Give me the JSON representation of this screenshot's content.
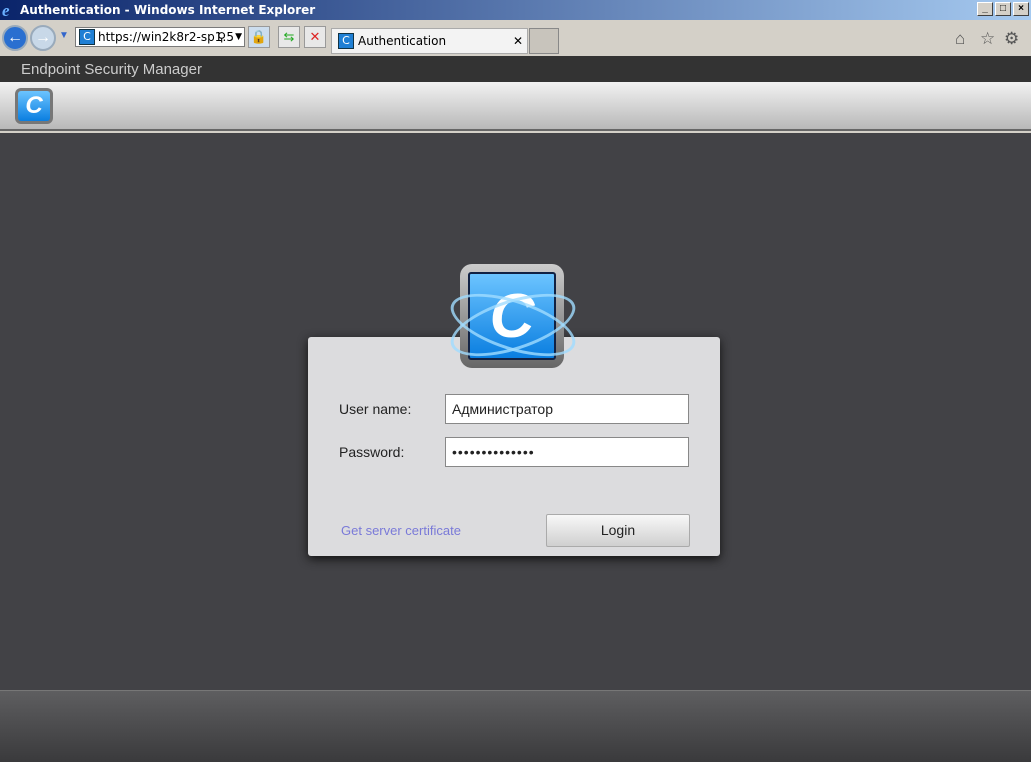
{
  "window": {
    "title": "Authentication - Windows Internet Explorer"
  },
  "browser": {
    "url": "https://win2k8r2-sp1:5",
    "tab_label": "Authentication"
  },
  "app": {
    "title": "Endpoint Security Manager"
  },
  "login": {
    "username_label": "User name:",
    "username_value": "Администратор",
    "password_label": "Password:",
    "password_value": "••••••••••••••",
    "cert_link": "Get server certificate",
    "login_button": "Login"
  }
}
